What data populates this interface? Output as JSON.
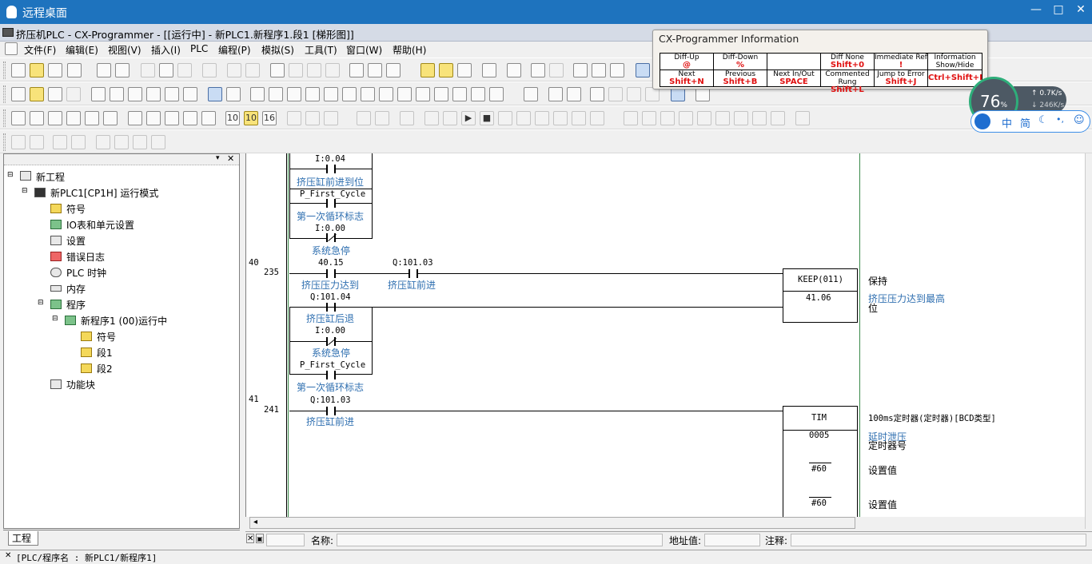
{
  "remote": {
    "title": "远程桌面",
    "min": "—",
    "max": "□",
    "close": "✕"
  },
  "app": {
    "title": "挤压机PLC - CX-Programmer - [[运行中] - 新PLC1.新程序1.段1 [梯形图]]"
  },
  "menu": [
    "文件(F)",
    "编辑(E)",
    "视图(V)",
    "插入(I)",
    "PLC",
    "编程(P)",
    "模拟(S)",
    "工具(T)",
    "窗口(W)",
    "帮助(H)"
  ],
  "info_panel": {
    "title": "CX-Programmer Information",
    "top_labels": [
      "Diff-Up",
      "Diff-Down",
      "Diff None",
      "Immediate Ref",
      "Information Show/Hide"
    ],
    "top_keys": [
      "@",
      "%",
      "Shift+0",
      "!",
      ""
    ],
    "bottom_labels": [
      "Next",
      "Previous",
      "Next In/Out",
      "Commented Rung",
      "Jump to Error",
      ""
    ],
    "bottom_keys": [
      "Shift+N",
      "Shift+B",
      "SPACE",
      "Shift+L",
      "Shift+J",
      "Ctrl+Shift+I"
    ]
  },
  "net_widget": {
    "percent": "76",
    "unit": "%",
    "up": "0.7",
    "up_unit": "K/s",
    "down": "246",
    "down_unit": "K/s"
  },
  "ime": {
    "label1": "中",
    "label2": "简"
  },
  "tree": {
    "root": "新工程",
    "plc": "新PLC1[CP1H] 运行模式",
    "items": [
      "符号",
      "IO表和单元设置",
      "设置",
      "错误日志",
      "PLC 时钟",
      "内存",
      "程序"
    ],
    "program": "新程序1 (00)运行中",
    "sub": [
      "符号",
      "段1",
      "段2"
    ],
    "func": "功能块"
  },
  "tab_label": "工程",
  "ladder": {
    "r0": {
      "a1": "I:0.04",
      "c1": "挤压缸前进到位",
      "a2": "P_First_Cycle",
      "c2": "第一次循环标志",
      "a3": "I:0.00",
      "c3": "系统急停"
    },
    "r40": {
      "num": "40",
      "step": "235",
      "a1": "40.15",
      "c1": "挤压压力达到",
      "a2": "Q:101.03",
      "c2": "挤压缸前进",
      "a3": "Q:101.04",
      "c3": "挤压缸后退",
      "a4": "I:0.00",
      "c4": "系统急停",
      "a5": "P_First_Cycle",
      "c5": "第一次循环标志",
      "fb": "KEEP(011)",
      "fb_out": "41.06",
      "fb_cmt": "保持",
      "out_cmt1": "挤压压力达到最高",
      "out_cmt2": "位"
    },
    "r41": {
      "num": "41",
      "step": "241",
      "a1": "Q:101.03",
      "c1": "挤压缸前进",
      "fb": "TIM",
      "fb_cmt": "100ms定时器(定时器)[BCD类型]",
      "p1": "0005",
      "p1_c1": "延时泄压",
      "p1_c2": "定时器号",
      "p2": "#60",
      "p2_c": "设置值",
      "p3": "#60",
      "p3_c": "设置值"
    }
  },
  "status": {
    "name_label": "名称:",
    "addr_label": "地址值:",
    "note_label": "注释:"
  },
  "bottom": {
    "text": "[PLC/程序名 : 新PLC1/新程序1]"
  }
}
